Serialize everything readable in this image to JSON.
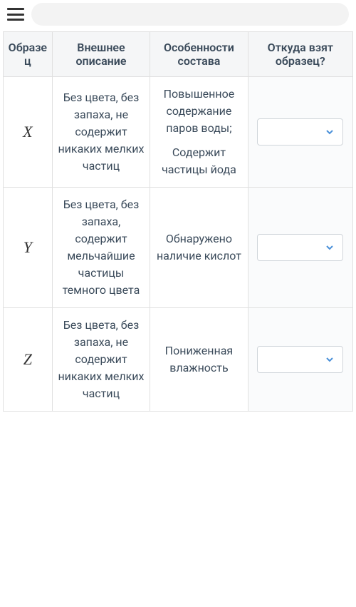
{
  "table": {
    "headers": {
      "sample": "Образец",
      "description": "Внешнее описание",
      "composition": "Особенности состава",
      "where": "Откуда взят образец?"
    },
    "rows": [
      {
        "sample": "X",
        "description": "Без цвета, без запаха, не содержит никаких мелких частиц",
        "composition1": "Повышенное содержание паров воды;",
        "composition2": "Содержит частицы йода",
        "dropdown_value": ""
      },
      {
        "sample": "Y",
        "description": "Без цвета, без запаха, содержит мельчайшие частицы темного цвета",
        "composition1": "Обнаружено наличие кислот",
        "composition2": "",
        "dropdown_value": ""
      },
      {
        "sample": "Z",
        "description": "Без цвета, без запаха, не содержит никаких мелких частиц",
        "composition1": "Пониженная влажность",
        "composition2": "",
        "dropdown_value": ""
      }
    ]
  },
  "colors": {
    "chevron": "#4a90d9"
  }
}
